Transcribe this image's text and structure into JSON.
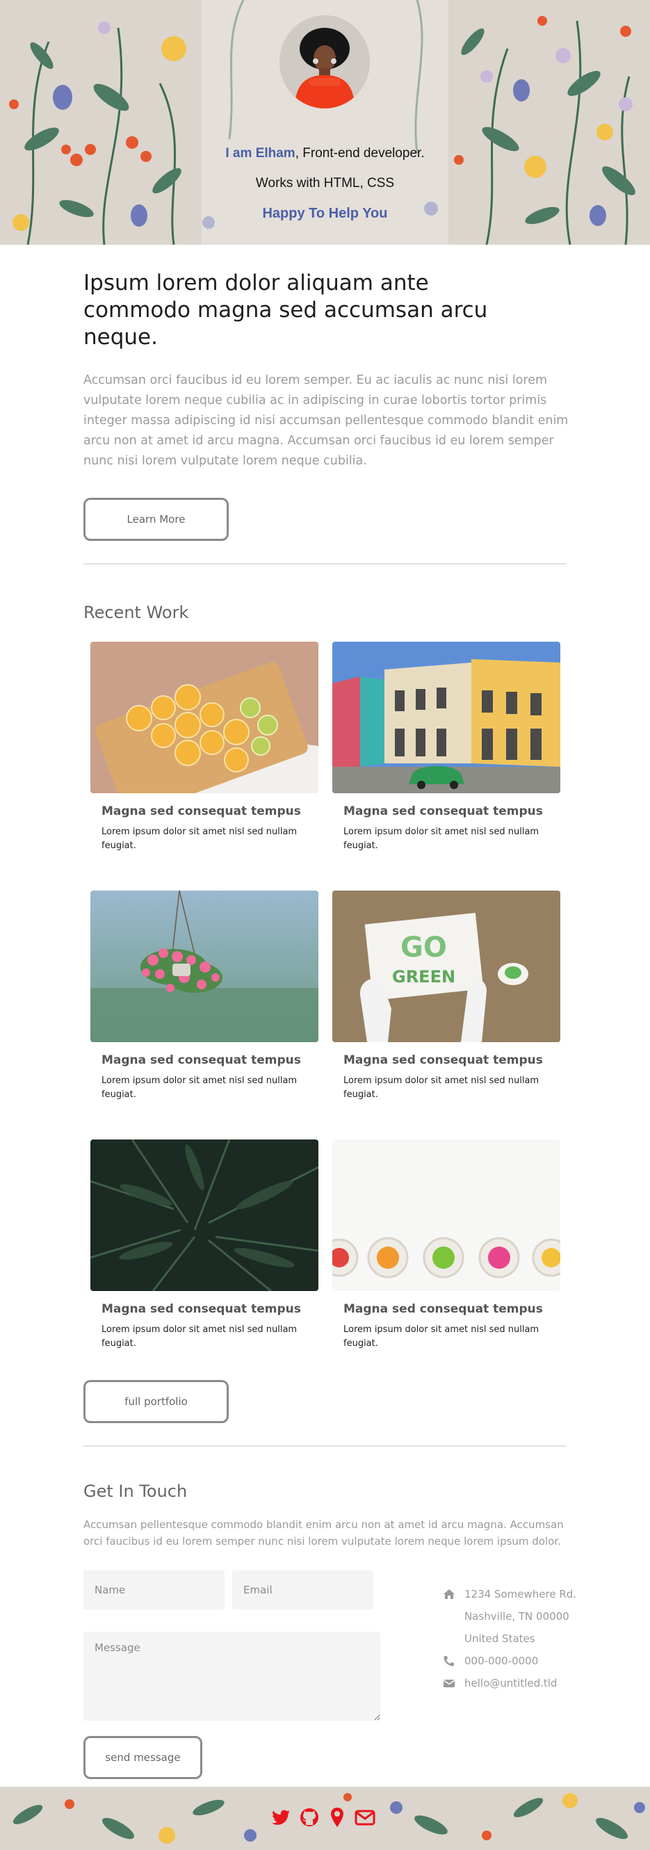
{
  "header": {
    "name_prefix": "I am ",
    "name": "Elham",
    "role": ", Front-end developer.",
    "skills": "Works with HTML, CSS",
    "tagline": "Happy To Help You"
  },
  "intro": {
    "title": "Ipsum lorem dolor aliquam ante commodo magna sed accumsan arcu neque.",
    "text": "Accumsan orci faucibus id eu lorem semper. Eu ac iaculis ac nunc nisi lorem vulputate lorem neque cubilia ac in adipiscing in curae lobortis tortor primis integer massa adipiscing id nisi accumsan pellentesque commodo blandit enim arcu non at amet id arcu magna. Accumsan orci faucibus id eu lorem semper nunc nisi lorem vulputate lorem neque cubilia.",
    "button_label": "Learn More"
  },
  "recent_work": {
    "title": "Recent Work",
    "items": [
      {
        "title": "Magna sed consequat tempus",
        "text": "Lorem ipsum dolor sit amet nisl sed nullam feugiat.",
        "image": "citrus-slices"
      },
      {
        "title": "Magna sed consequat tempus",
        "text": "Lorem ipsum dolor sit amet nisl sed nullam feugiat.",
        "image": "colorful-street"
      },
      {
        "title": "Magna sed consequat tempus",
        "text": "Lorem ipsum dolor sit amet nisl sed nullam feugiat.",
        "image": "hanging-flowers"
      },
      {
        "title": "Magna sed consequat tempus",
        "text": "Lorem ipsum dolor sit amet nisl sed nullam feugiat.",
        "image": "go-green-sign"
      },
      {
        "title": "Magna sed consequat tempus",
        "text": "Lorem ipsum dolor sit amet nisl sed nullam feugiat.",
        "image": "fern-leaves"
      },
      {
        "title": "Magna sed consequat tempus",
        "text": "Lorem ipsum dolor sit amet nisl sed nullam feugiat.",
        "image": "flower-bowls"
      }
    ],
    "sign_text": "GO",
    "sign_text2": "GREEN",
    "button_label": "full portfolio"
  },
  "contact": {
    "title": "Get In Touch",
    "text": "Accumsan pellentesque commodo blandit enim arcu non at amet id arcu magna. Accumsan orci faucibus id eu lorem semper nunc nisi lorem vulputate lorem neque lorem ipsum dolor.",
    "name_placeholder": "Name",
    "email_placeholder": "Email",
    "message_placeholder": "Message",
    "button_label": "send message",
    "address_line1": "1234 Somewhere Rd.",
    "address_line2": "Nashville, TN 00000",
    "address_line3": "United States",
    "phone": "000-000-0000",
    "email": "hello@untitled.tld"
  },
  "footer": {
    "icons": [
      "twitter-icon",
      "github-icon",
      "location-pin-icon",
      "envelope-icon"
    ],
    "icon_color": "#e8141b"
  },
  "colors": {
    "accent": "#4a5fa8",
    "text_muted": "#9a9a9a",
    "border": "#8a8a8a"
  }
}
